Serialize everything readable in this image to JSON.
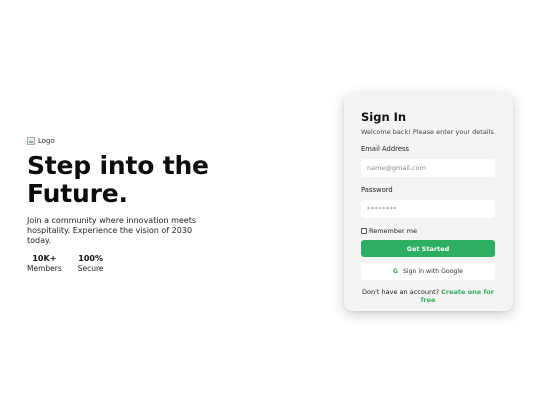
{
  "hero": {
    "logo_alt": "Logo",
    "headline_line1": "Step into the",
    "headline_line2": "Future.",
    "tagline": "Join a community where innovation meets hospitality. Experience the vision of 2030 today.",
    "stats": [
      {
        "value": "10K+",
        "label": "Members"
      },
      {
        "value": "100%",
        "label": "Secure"
      }
    ]
  },
  "signin": {
    "title": "Sign In",
    "subtitle": "Welcome back! Please enter your details.",
    "email_label": "Email Address",
    "email_placeholder": "name@gmail.com",
    "password_label": "Password",
    "password_placeholder": "********",
    "remember_label": "Remember me",
    "remember_checked": false,
    "submit_label": "Get Started",
    "google_label": "Sign in with Google",
    "no_account_text": "Don't have an account?",
    "create_link": "Create one for free"
  },
  "colors": {
    "accent": "#2eae62",
    "card_bg": "#f5f4f4",
    "google_icon": "#34a853"
  },
  "icons": {
    "logo": "broken-image-icon",
    "google": "google-g-icon"
  }
}
